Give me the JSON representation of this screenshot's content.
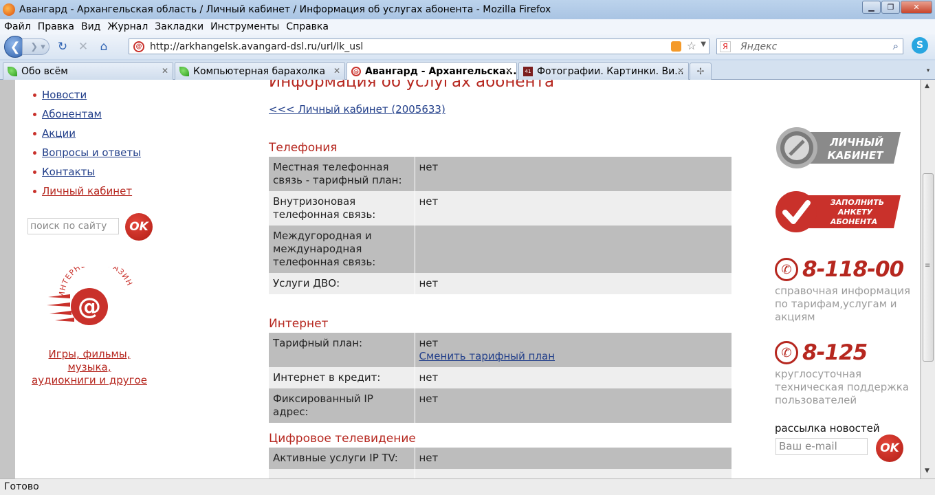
{
  "window": {
    "title": "Авангард - Архангельская область / Личный кабинет / Информация об услугах абонента - Mozilla Firefox"
  },
  "menu": [
    "Файл",
    "Правка",
    "Вид",
    "Журнал",
    "Закладки",
    "Инструменты",
    "Справка"
  ],
  "navbar": {
    "url": "http://arkhangelsk.avangard-dsl.ru/url/lk_usl",
    "search_placeholder": "Яндекс"
  },
  "tabs": [
    {
      "label": "Обо всём",
      "active": false
    },
    {
      "label": "Компьютерная барахолка",
      "active": false
    },
    {
      "label": "Авангард - Архангельска...",
      "active": true
    },
    {
      "label": "Фотографии. Картинки. Ви...",
      "active": false
    }
  ],
  "sidebar": {
    "items": [
      {
        "label": "Новости"
      },
      {
        "label": "Абонентам"
      },
      {
        "label": "Акции"
      },
      {
        "label": "Вопросы и ответы"
      },
      {
        "label": "Контакты"
      },
      {
        "label": "Личный кабинет"
      }
    ],
    "search_placeholder": "поиск по сайту",
    "ok_label": "OK",
    "shop_logo_text": "ИНТЕРНЕТ-МАГАЗИН",
    "shop_links": [
      "Игры, фильмы,",
      "музыка,",
      "аудиокниги и другое"
    ]
  },
  "main": {
    "title": "Информация об услугах абонента",
    "back_link": "<<< Личный кабинет (2005633)",
    "sections": [
      {
        "title": "Телефония",
        "rows": [
          {
            "key": "Местная телефонная связь - тарифный план:",
            "value": "нет"
          },
          {
            "key": "Внутризоновая телефонная связь:",
            "value": "нет"
          },
          {
            "key": "Междугородная и международная телефонная связь:",
            "value": ""
          },
          {
            "key": "Услуги ДВО:",
            "value": "нет"
          }
        ]
      },
      {
        "title": "Интернет",
        "rows": [
          {
            "key": "Тарифный план:",
            "value": "нет",
            "link": "Сменить тарифный план"
          },
          {
            "key": "Интернет в кредит:",
            "value": "нет"
          },
          {
            "key": "Фиксированный IP адрес:",
            "value": "нет"
          }
        ]
      },
      {
        "title": "Цифровое телевидение",
        "rows": [
          {
            "key": "Активные услуги IP TV:",
            "value": "нет"
          }
        ]
      }
    ]
  },
  "right": {
    "lk_banner": [
      "ЛИЧНЫЙ",
      "КАБИНЕТ"
    ],
    "anketa_banner": [
      "ЗАПОЛНИТЬ",
      "АНКЕТУ",
      "АБОНЕНТА"
    ],
    "phones": [
      {
        "number": "8-118-00",
        "desc": "справочная информация по тарифам,услугам и акциям"
      },
      {
        "number": "8-125",
        "desc": "круглосуточная техническая поддержка пользователей"
      }
    ],
    "newsletter_label": "рассылка новостей",
    "email_placeholder": "Ваш e-mail",
    "ok_label": "OK"
  },
  "status": "Готово",
  "colors": {
    "accent": "#b6271f",
    "link": "#223f8a"
  }
}
